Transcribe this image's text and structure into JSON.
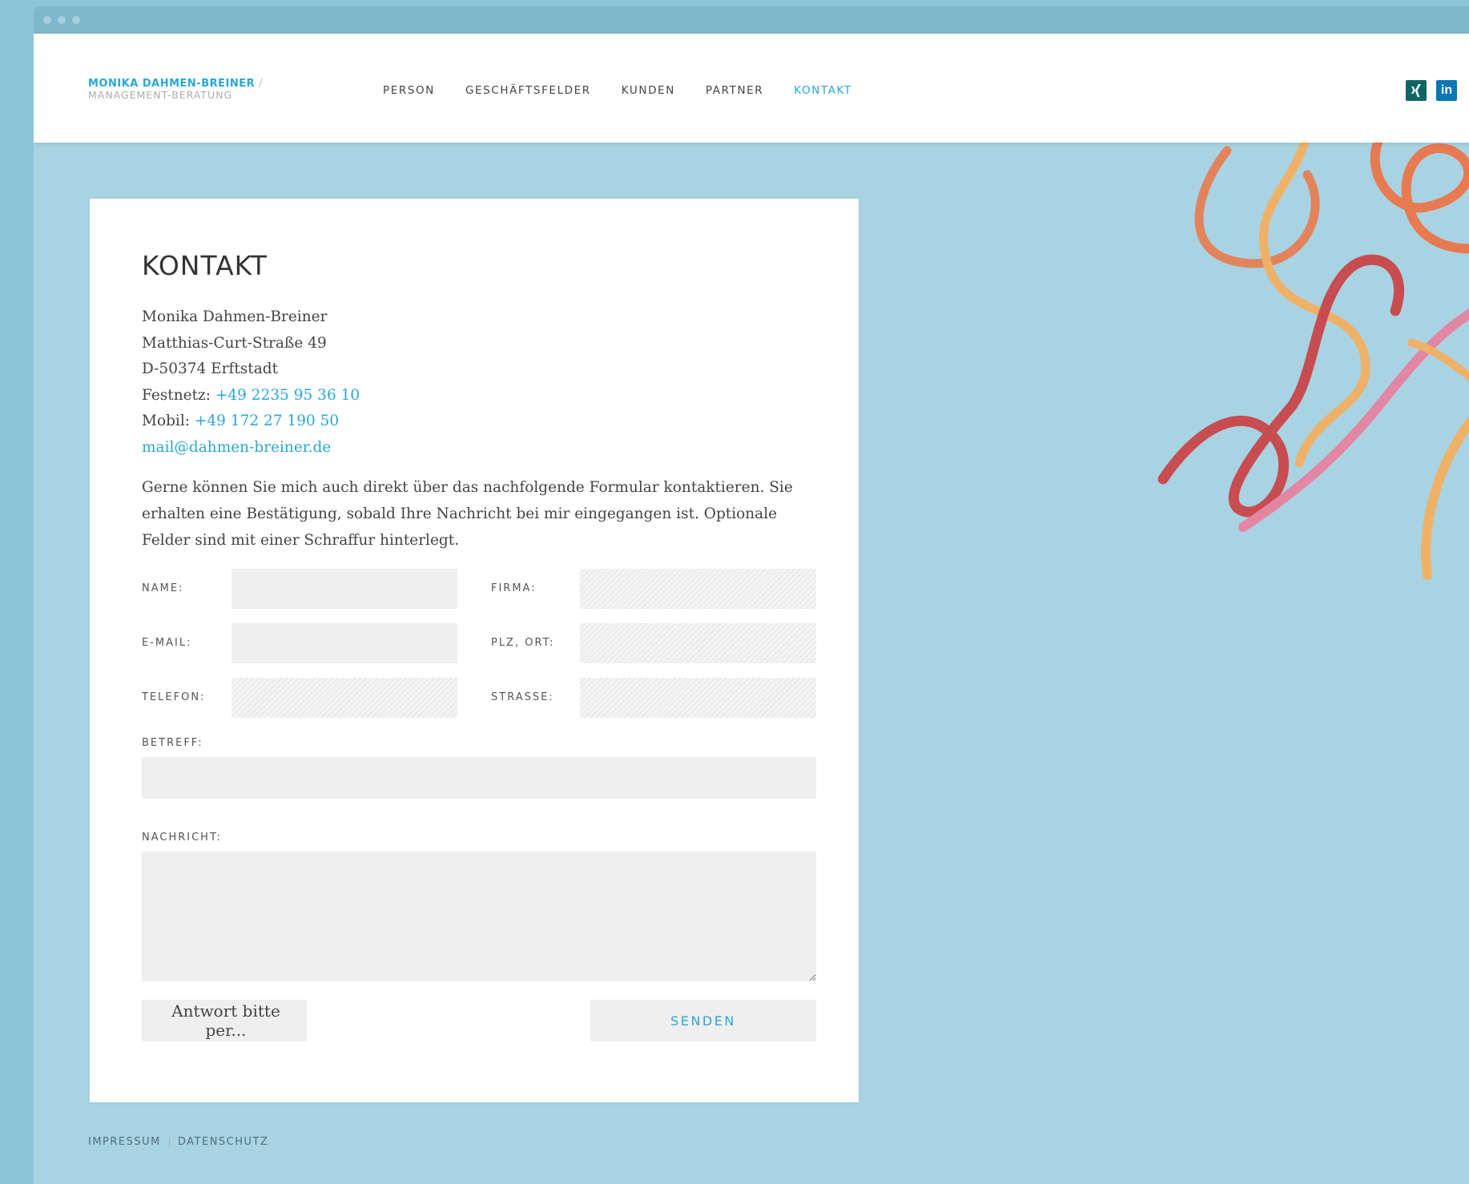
{
  "brand": {
    "name": "MONIKA DAHMEN-BREINER",
    "slash": "/",
    "subtitle": "MANAGEMENT-BERATUNG"
  },
  "nav": {
    "items": [
      {
        "label": "PERSON"
      },
      {
        "label": "GESCHÄFTSFELDER"
      },
      {
        "label": "KUNDEN"
      },
      {
        "label": "PARTNER"
      },
      {
        "label": "KONTAKT",
        "active": true
      }
    ]
  },
  "social": {
    "xing": {
      "icon": "xing-icon",
      "glyph": "✕"
    },
    "linkedin": {
      "icon": "linkedin-icon",
      "glyph": "in"
    }
  },
  "contact": {
    "title": "KONTAKT",
    "name": "Monika Dahmen-Breiner",
    "street": "Matthias-Curt-Straße 49",
    "city": "D-50374 Erftstadt",
    "landline_label": "Festnetz:",
    "landline": "+49 2235 95 36 10",
    "mobile_label": "Mobil:",
    "mobile": "+49 172 27 190 50",
    "email": "mail@dahmen-breiner.de",
    "intro": "Gerne können Sie mich auch direkt über das nachfolgende Formular kontaktieren. Sie erhalten eine Bestätigung, sobald Ihre Nachricht bei mir eingegangen ist. Optionale Felder sind mit einer Schraffur hinterlegt."
  },
  "form": {
    "name_label": "NAME:",
    "company_label": "FIRMA:",
    "email_label": "E-MAIL:",
    "zip_label": "PLZ, ORT:",
    "phone_label": "TELEFON:",
    "street_label": "STRASSE:",
    "subject_label": "BETREFF:",
    "message_label": "NACHRICHT:",
    "reply_select": "Antwort bitte per...",
    "send": "SENDEN"
  },
  "footer": {
    "imprint": "IMPRESSUM",
    "privacy": "DATENSCHUTZ"
  },
  "colors": {
    "accent": "#2aa6d6",
    "background": "#a9d3e2",
    "xing": "#126567",
    "linkedin": "#0a77b5"
  }
}
